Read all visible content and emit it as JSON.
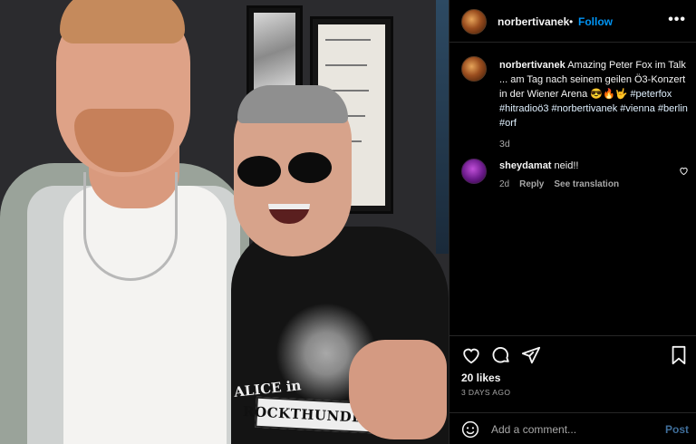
{
  "post": {
    "author": "norbertivanek",
    "follow_label": "Follow",
    "more_label": "•••",
    "caption_text": "Amazing Peter Fox im Talk ... am Tag nach seinem geilen Ö3-Konzert in der Wiener Arena 😎🔥🤟",
    "caption_tags": "#peterfox #hitradioö3 #norbertivanek #vienna #berlin #orf",
    "caption_age": "3d"
  },
  "comments": [
    {
      "user": "sheydamat",
      "text": "neid!!",
      "age": "2d",
      "reply_label": "Reply",
      "translate_label": "See translation"
    }
  ],
  "engagement": {
    "likes": "20 likes",
    "posted_ago": "3 DAYS AGO"
  },
  "add_comment": {
    "placeholder": "Add a comment...",
    "post_label": "Post"
  },
  "photo": {
    "shirt_text_top": "ALICE in",
    "shirt_text_banner": "ROCKTHUNDERLAND"
  },
  "icons": [
    "heart-icon",
    "comment-icon",
    "share-icon",
    "bookmark-icon",
    "emoji-icon",
    "more-icon"
  ],
  "colors": {
    "follow": "#0095f6",
    "background": "#000000",
    "muted": "#a8a8a8"
  }
}
